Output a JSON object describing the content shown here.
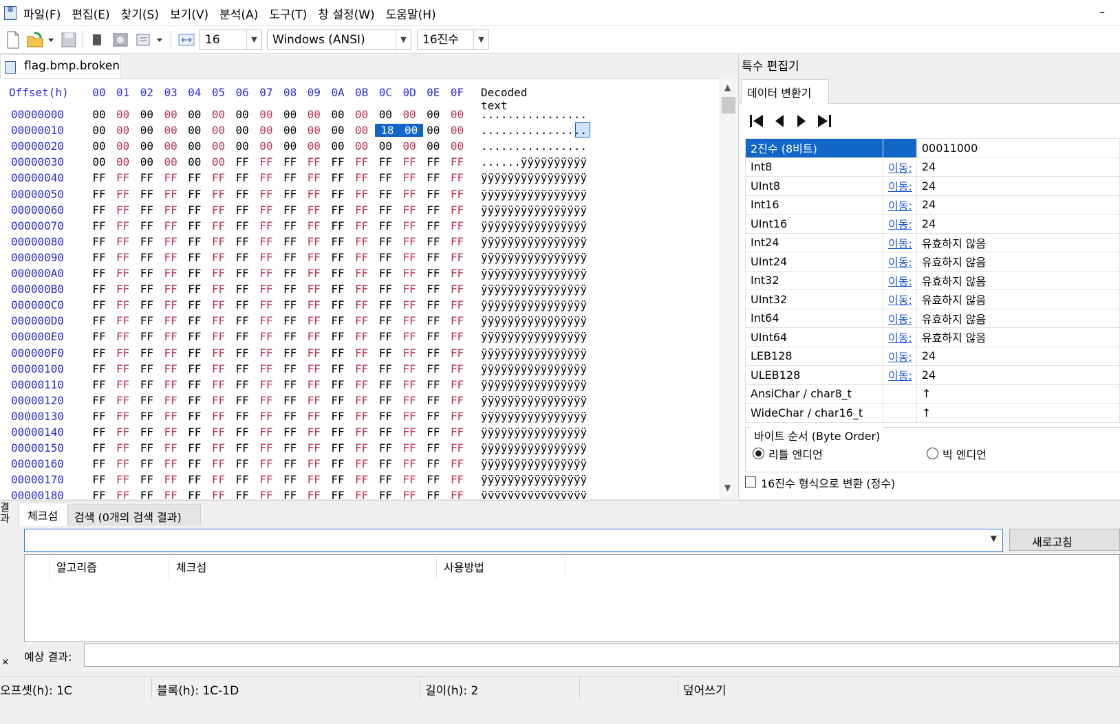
{
  "menu": [
    "파일(F)",
    "편집(E)",
    "찾기(S)",
    "보기(V)",
    "분석(A)",
    "도구(T)",
    "창 설정(W)",
    "도움말(H)"
  ],
  "window": {
    "minimize": "–"
  },
  "toolbar": {
    "bytes_per_row": "16",
    "encoding": "Windows (ANSI)",
    "number_base": "16진수"
  },
  "document": {
    "tab_label": "flag.bmp.broken"
  },
  "hex": {
    "header_offset": "Offset(h)",
    "columns": [
      "00",
      "01",
      "02",
      "03",
      "04",
      "05",
      "06",
      "07",
      "08",
      "09",
      "0A",
      "0B",
      "0C",
      "0D",
      "0E",
      "0F"
    ],
    "header_decoded": "Decoded text",
    "rows": [
      {
        "offset": "00000000",
        "bytes": [
          "00",
          "00",
          "00",
          "00",
          "00",
          "00",
          "00",
          "00",
          "00",
          "00",
          "00",
          "00",
          "00",
          "00",
          "00",
          "00"
        ],
        "text": "................"
      },
      {
        "offset": "00000010",
        "bytes": [
          "00",
          "00",
          "00",
          "00",
          "00",
          "00",
          "00",
          "00",
          "00",
          "00",
          "00",
          "00",
          "18",
          "00",
          "00",
          "00"
        ],
        "text": "................"
      },
      {
        "offset": "00000020",
        "bytes": [
          "00",
          "00",
          "00",
          "00",
          "00",
          "00",
          "00",
          "00",
          "00",
          "00",
          "00",
          "00",
          "00",
          "00",
          "00",
          "00"
        ],
        "text": "................"
      },
      {
        "offset": "00000030",
        "bytes": [
          "00",
          "00",
          "00",
          "00",
          "00",
          "00",
          "FF",
          "FF",
          "FF",
          "FF",
          "FF",
          "FF",
          "FF",
          "FF",
          "FF",
          "FF"
        ],
        "text": "......ÿÿÿÿÿÿÿÿÿÿ"
      },
      {
        "offset": "00000040",
        "bytes": [
          "FF",
          "FF",
          "FF",
          "FF",
          "FF",
          "FF",
          "FF",
          "FF",
          "FF",
          "FF",
          "FF",
          "FF",
          "FF",
          "FF",
          "FF",
          "FF"
        ],
        "text": "ÿÿÿÿÿÿÿÿÿÿÿÿÿÿÿÿ"
      },
      {
        "offset": "00000050",
        "bytes": [
          "FF",
          "FF",
          "FF",
          "FF",
          "FF",
          "FF",
          "FF",
          "FF",
          "FF",
          "FF",
          "FF",
          "FF",
          "FF",
          "FF",
          "FF",
          "FF"
        ],
        "text": "ÿÿÿÿÿÿÿÿÿÿÿÿÿÿÿÿ"
      },
      {
        "offset": "00000060",
        "bytes": [
          "FF",
          "FF",
          "FF",
          "FF",
          "FF",
          "FF",
          "FF",
          "FF",
          "FF",
          "FF",
          "FF",
          "FF",
          "FF",
          "FF",
          "FF",
          "FF"
        ],
        "text": "ÿÿÿÿÿÿÿÿÿÿÿÿÿÿÿÿ"
      },
      {
        "offset": "00000070",
        "bytes": [
          "FF",
          "FF",
          "FF",
          "FF",
          "FF",
          "FF",
          "FF",
          "FF",
          "FF",
          "FF",
          "FF",
          "FF",
          "FF",
          "FF",
          "FF",
          "FF"
        ],
        "text": "ÿÿÿÿÿÿÿÿÿÿÿÿÿÿÿÿ"
      },
      {
        "offset": "00000080",
        "bytes": [
          "FF",
          "FF",
          "FF",
          "FF",
          "FF",
          "FF",
          "FF",
          "FF",
          "FF",
          "FF",
          "FF",
          "FF",
          "FF",
          "FF",
          "FF",
          "FF"
        ],
        "text": "ÿÿÿÿÿÿÿÿÿÿÿÿÿÿÿÿ"
      },
      {
        "offset": "00000090",
        "bytes": [
          "FF",
          "FF",
          "FF",
          "FF",
          "FF",
          "FF",
          "FF",
          "FF",
          "FF",
          "FF",
          "FF",
          "FF",
          "FF",
          "FF",
          "FF",
          "FF"
        ],
        "text": "ÿÿÿÿÿÿÿÿÿÿÿÿÿÿÿÿ"
      },
      {
        "offset": "000000A0",
        "bytes": [
          "FF",
          "FF",
          "FF",
          "FF",
          "FF",
          "FF",
          "FF",
          "FF",
          "FF",
          "FF",
          "FF",
          "FF",
          "FF",
          "FF",
          "FF",
          "FF"
        ],
        "text": "ÿÿÿÿÿÿÿÿÿÿÿÿÿÿÿÿ"
      },
      {
        "offset": "000000B0",
        "bytes": [
          "FF",
          "FF",
          "FF",
          "FF",
          "FF",
          "FF",
          "FF",
          "FF",
          "FF",
          "FF",
          "FF",
          "FF",
          "FF",
          "FF",
          "FF",
          "FF"
        ],
        "text": "ÿÿÿÿÿÿÿÿÿÿÿÿÿÿÿÿ"
      },
      {
        "offset": "000000C0",
        "bytes": [
          "FF",
          "FF",
          "FF",
          "FF",
          "FF",
          "FF",
          "FF",
          "FF",
          "FF",
          "FF",
          "FF",
          "FF",
          "FF",
          "FF",
          "FF",
          "FF"
        ],
        "text": "ÿÿÿÿÿÿÿÿÿÿÿÿÿÿÿÿ"
      },
      {
        "offset": "000000D0",
        "bytes": [
          "FF",
          "FF",
          "FF",
          "FF",
          "FF",
          "FF",
          "FF",
          "FF",
          "FF",
          "FF",
          "FF",
          "FF",
          "FF",
          "FF",
          "FF",
          "FF"
        ],
        "text": "ÿÿÿÿÿÿÿÿÿÿÿÿÿÿÿÿ"
      },
      {
        "offset": "000000E0",
        "bytes": [
          "FF",
          "FF",
          "FF",
          "FF",
          "FF",
          "FF",
          "FF",
          "FF",
          "FF",
          "FF",
          "FF",
          "FF",
          "FF",
          "FF",
          "FF",
          "FF"
        ],
        "text": "ÿÿÿÿÿÿÿÿÿÿÿÿÿÿÿÿ"
      },
      {
        "offset": "000000F0",
        "bytes": [
          "FF",
          "FF",
          "FF",
          "FF",
          "FF",
          "FF",
          "FF",
          "FF",
          "FF",
          "FF",
          "FF",
          "FF",
          "FF",
          "FF",
          "FF",
          "FF"
        ],
        "text": "ÿÿÿÿÿÿÿÿÿÿÿÿÿÿÿÿ"
      },
      {
        "offset": "00000100",
        "bytes": [
          "FF",
          "FF",
          "FF",
          "FF",
          "FF",
          "FF",
          "FF",
          "FF",
          "FF",
          "FF",
          "FF",
          "FF",
          "FF",
          "FF",
          "FF",
          "FF"
        ],
        "text": "ÿÿÿÿÿÿÿÿÿÿÿÿÿÿÿÿ"
      },
      {
        "offset": "00000110",
        "bytes": [
          "FF",
          "FF",
          "FF",
          "FF",
          "FF",
          "FF",
          "FF",
          "FF",
          "FF",
          "FF",
          "FF",
          "FF",
          "FF",
          "FF",
          "FF",
          "FF"
        ],
        "text": "ÿÿÿÿÿÿÿÿÿÿÿÿÿÿÿÿ"
      },
      {
        "offset": "00000120",
        "bytes": [
          "FF",
          "FF",
          "FF",
          "FF",
          "FF",
          "FF",
          "FF",
          "FF",
          "FF",
          "FF",
          "FF",
          "FF",
          "FF",
          "FF",
          "FF",
          "FF"
        ],
        "text": "ÿÿÿÿÿÿÿÿÿÿÿÿÿÿÿÿ"
      },
      {
        "offset": "00000130",
        "bytes": [
          "FF",
          "FF",
          "FF",
          "FF",
          "FF",
          "FF",
          "FF",
          "FF",
          "FF",
          "FF",
          "FF",
          "FF",
          "FF",
          "FF",
          "FF",
          "FF"
        ],
        "text": "ÿÿÿÿÿÿÿÿÿÿÿÿÿÿÿÿ"
      },
      {
        "offset": "00000140",
        "bytes": [
          "FF",
          "FF",
          "FF",
          "FF",
          "FF",
          "FF",
          "FF",
          "FF",
          "FF",
          "FF",
          "FF",
          "FF",
          "FF",
          "FF",
          "FF",
          "FF"
        ],
        "text": "ÿÿÿÿÿÿÿÿÿÿÿÿÿÿÿÿ"
      },
      {
        "offset": "00000150",
        "bytes": [
          "FF",
          "FF",
          "FF",
          "FF",
          "FF",
          "FF",
          "FF",
          "FF",
          "FF",
          "FF",
          "FF",
          "FF",
          "FF",
          "FF",
          "FF",
          "FF"
        ],
        "text": "ÿÿÿÿÿÿÿÿÿÿÿÿÿÿÿÿ"
      },
      {
        "offset": "00000160",
        "bytes": [
          "FF",
          "FF",
          "FF",
          "FF",
          "FF",
          "FF",
          "FF",
          "FF",
          "FF",
          "FF",
          "FF",
          "FF",
          "FF",
          "FF",
          "FF",
          "FF"
        ],
        "text": "ÿÿÿÿÿÿÿÿÿÿÿÿÿÿÿÿ"
      },
      {
        "offset": "00000170",
        "bytes": [
          "FF",
          "FF",
          "FF",
          "FF",
          "FF",
          "FF",
          "FF",
          "FF",
          "FF",
          "FF",
          "FF",
          "FF",
          "FF",
          "FF",
          "FF",
          "FF"
        ],
        "text": "ÿÿÿÿÿÿÿÿÿÿÿÿÿÿÿÿ"
      },
      {
        "offset": "00000180",
        "bytes": [
          "FF",
          "FF",
          "FF",
          "FF",
          "FF",
          "FF",
          "FF",
          "FF",
          "FF",
          "FF",
          "FF",
          "FF",
          "FF",
          "FF",
          "FF",
          "FF"
        ],
        "text": "ÿÿÿÿÿÿÿÿÿÿÿÿÿÿÿÿ"
      }
    ],
    "selected_bytes": [
      "0x1C",
      "0x1D"
    ]
  },
  "special_editor": {
    "title": "특수 편집기",
    "tab": "데이터 변환기",
    "rows": [
      {
        "name": "2진수 (8비트)",
        "link": "",
        "value": "00011000"
      },
      {
        "name": "Int8",
        "link": "이동:",
        "value": "24"
      },
      {
        "name": "UInt8",
        "link": "이동:",
        "value": "24"
      },
      {
        "name": "Int16",
        "link": "이동:",
        "value": "24"
      },
      {
        "name": "UInt16",
        "link": "이동:",
        "value": "24"
      },
      {
        "name": "Int24",
        "link": "이동:",
        "value": "유효하지 않음"
      },
      {
        "name": "UInt24",
        "link": "이동:",
        "value": "유효하지 않음"
      },
      {
        "name": "Int32",
        "link": "이동:",
        "value": "유효하지 않음"
      },
      {
        "name": "UInt32",
        "link": "이동:",
        "value": "유효하지 않음"
      },
      {
        "name": "Int64",
        "link": "이동:",
        "value": "유효하지 않음"
      },
      {
        "name": "UInt64",
        "link": "이동:",
        "value": "유효하지 않음"
      },
      {
        "name": "LEB128",
        "link": "이동:",
        "value": "24"
      },
      {
        "name": "ULEB128",
        "link": "이동:",
        "value": "24"
      },
      {
        "name": "AnsiChar / char8_t",
        "link": "",
        "value": "↑"
      },
      {
        "name": "WideChar / char16_t",
        "link": "",
        "value": "↑"
      }
    ],
    "byte_order_label": "바이트 순서 (Byte Order)",
    "little_endian": "리틀 엔디언",
    "big_endian": "빅 엔디언",
    "hex_checkbox": "16진수 형식으로 변환 (정수)"
  },
  "results": {
    "side_label": "결과",
    "tab_checksum": "체크섬",
    "tab_search": "검색 (0개의 검색 결과)",
    "refresh": "새로고침",
    "columns": [
      "알고리즘",
      "체크섬",
      "사용방법"
    ],
    "expected_label": "예상 결과:",
    "close": "×"
  },
  "status": {
    "offset": "오프셋(h): 1C",
    "block": "블록(h): 1C-1D",
    "length": "길이(h): 2",
    "mode": "덮어쓰기"
  }
}
